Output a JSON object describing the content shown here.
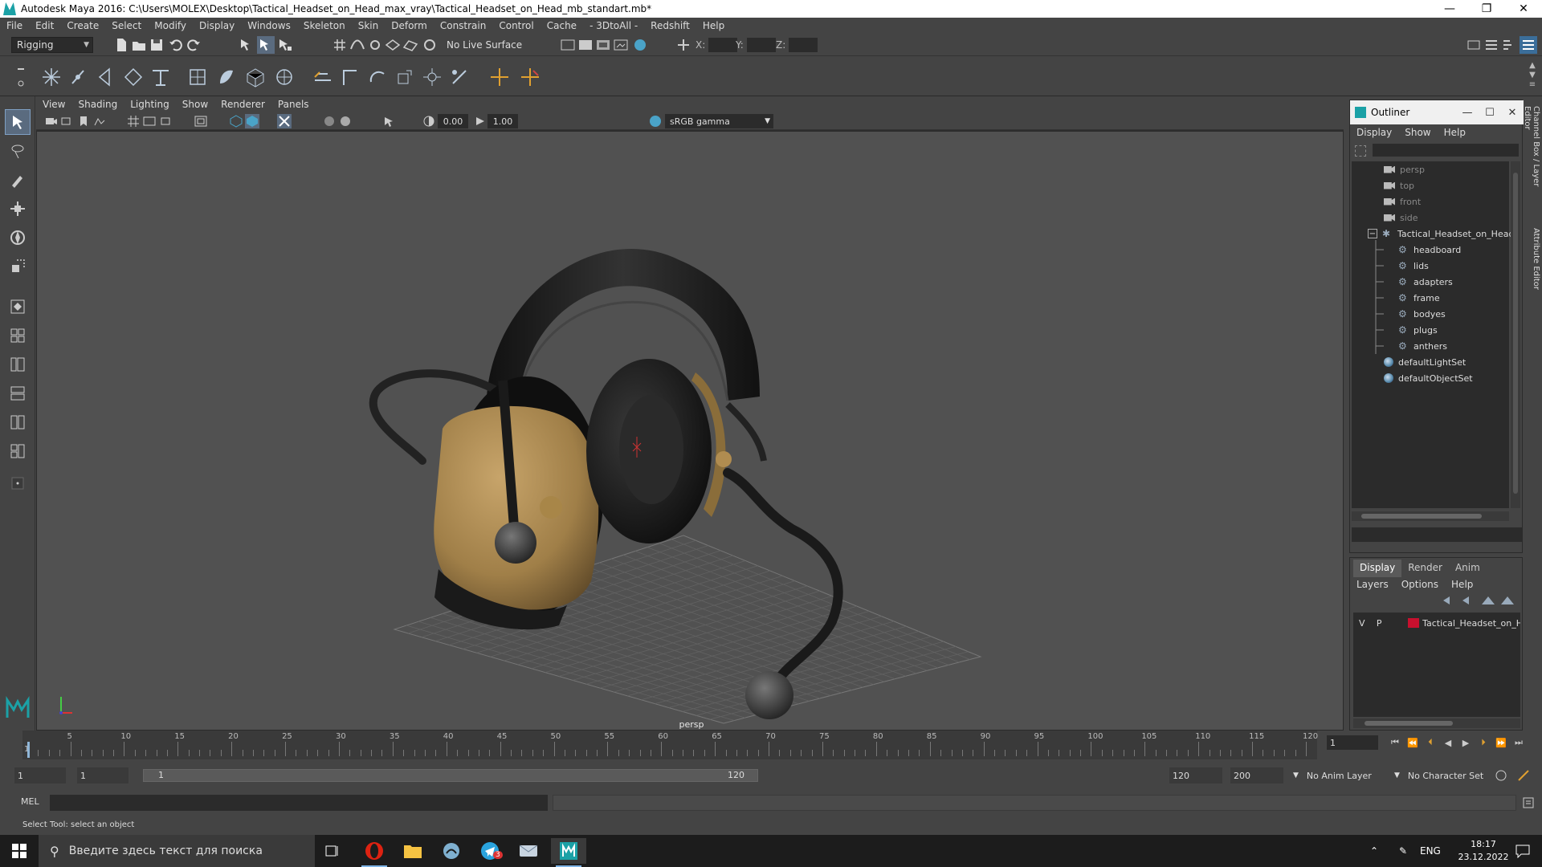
{
  "window": {
    "title": "Autodesk Maya 2016: C:\\Users\\MOLEX\\Desktop\\Tactical_Headset_on_Head_max_vray\\Tactical_Headset_on_Head_mb_standart.mb*",
    "minimize": "—",
    "restore": "❐",
    "close": "✕"
  },
  "menu": [
    "File",
    "Edit",
    "Create",
    "Select",
    "Modify",
    "Display",
    "Windows",
    "Skeleton",
    "Skin",
    "Deform",
    "Constrain",
    "Control",
    "Cache",
    "- 3DtoAll -",
    "Redshift",
    "Help"
  ],
  "statusline": {
    "mode": "Rigging",
    "live_surface": "No Live Surface",
    "x_label": "X:",
    "y_label": "Y:",
    "z_label": "Z:"
  },
  "panel": {
    "menu": [
      "View",
      "Shading",
      "Lighting",
      "Show",
      "Renderer",
      "Panels"
    ],
    "exposure": "0.00",
    "gamma_value": "1.00",
    "color_space": "sRGB gamma",
    "camera": "persp"
  },
  "outliner": {
    "title": "Outliner",
    "menu": [
      "Display",
      "Show",
      "Help"
    ],
    "items": [
      {
        "label": "persp",
        "type": "camera",
        "dim": true
      },
      {
        "label": "top",
        "type": "camera",
        "dim": true
      },
      {
        "label": "front",
        "type": "camera",
        "dim": true
      },
      {
        "label": "side",
        "type": "camera",
        "dim": true
      },
      {
        "label": "Tactical_Headset_on_Head",
        "type": "root"
      },
      {
        "label": "headboard",
        "type": "group"
      },
      {
        "label": "lids",
        "type": "group"
      },
      {
        "label": "adapters",
        "type": "group"
      },
      {
        "label": "frame",
        "type": "group"
      },
      {
        "label": "bodyes",
        "type": "group"
      },
      {
        "label": "plugs",
        "type": "group"
      },
      {
        "label": "anthers",
        "type": "group"
      },
      {
        "label": "defaultLightSet",
        "type": "set"
      },
      {
        "label": "defaultObjectSet",
        "type": "set"
      }
    ]
  },
  "layer_editor": {
    "tabs": [
      "Display",
      "Render",
      "Anim"
    ],
    "menu": [
      "Layers",
      "Options",
      "Help"
    ],
    "layer": {
      "v": "V",
      "p": "P",
      "name": "Tactical_Headset_on_H",
      "color": "#c8102e"
    }
  },
  "side_tabs": [
    "Channel Box / Layer Editor",
    "Attribute Editor"
  ],
  "timeline": {
    "ticks": [
      "1",
      "5",
      "10",
      "15",
      "20",
      "25",
      "30",
      "35",
      "40",
      "45",
      "50",
      "55",
      "60",
      "65",
      "70",
      "75",
      "80",
      "85",
      "90",
      "95",
      "100",
      "105",
      "110",
      "115",
      "120"
    ],
    "current_frame": "1"
  },
  "range": {
    "start": "1",
    "playback_start": "1",
    "bar_start": "1",
    "bar_end": "120",
    "playback_end": "120",
    "end": "200",
    "anim_layer": "No Anim Layer",
    "character_set": "No Character Set"
  },
  "command": {
    "label": "MEL"
  },
  "help_line": "Select Tool: select an object",
  "taskbar": {
    "search_placeholder": "Введите здесь текст для поиска",
    "lang": "ENG",
    "time": "18:17",
    "date": "23.12.2022",
    "badge": "3"
  },
  "colors": {
    "maya_teal": "#1ba1a6",
    "layer_red": "#c8102e",
    "active_tool": "#5a6b7f"
  }
}
